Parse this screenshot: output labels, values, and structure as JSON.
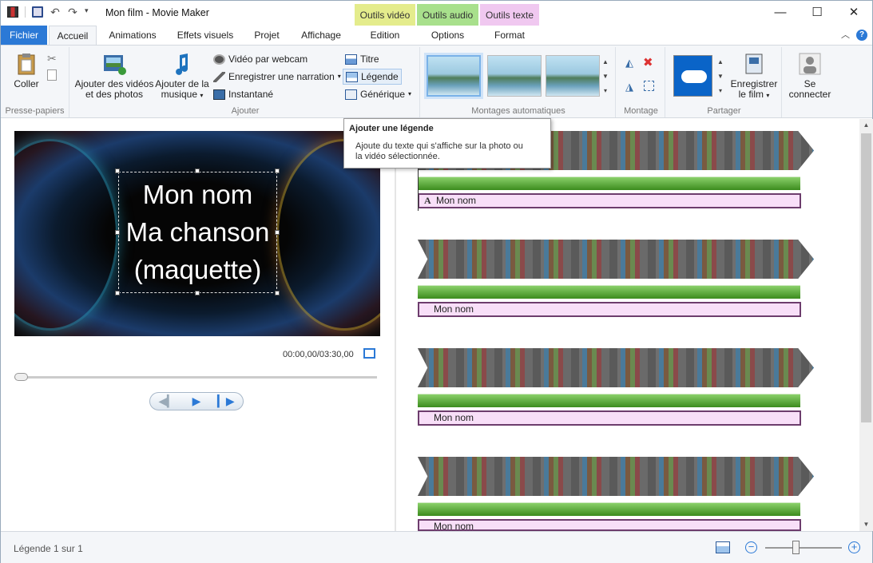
{
  "window": {
    "title": "Mon film - Movie Maker",
    "minimize_glyph": "—",
    "maximize_glyph": "☐",
    "close_glyph": "✕"
  },
  "context_groups": [
    {
      "label": "Outils vidéo",
      "color": "#e4ec8c"
    },
    {
      "label": "Outils audio",
      "color": "#a8e08c"
    },
    {
      "label": "Outils texte",
      "color": "#f0c8f0"
    }
  ],
  "tabs": {
    "file": "Fichier",
    "home": "Accueil",
    "animations": "Animations",
    "visual_effects": "Effets visuels",
    "project": "Projet",
    "view": "Affichage",
    "edit": "Edition",
    "options": "Options",
    "format": "Format"
  },
  "ribbon": {
    "clipboard": {
      "paste": "Coller",
      "group": "Presse-papiers"
    },
    "add": {
      "add_videos_line1": "Ajouter des vidéos",
      "add_videos_line2": "et des photos",
      "add_music_line1": "Ajouter de la",
      "add_music_line2": "musique",
      "webcam": "Vidéo par webcam",
      "narration": "Enregistrer une narration",
      "snapshot": "Instantané",
      "title": "Titre",
      "caption": "Légende",
      "credits": "Générique",
      "group": "Ajouter"
    },
    "automovie": {
      "group": "Montages automatiques"
    },
    "editing": {
      "group": "Montage"
    },
    "share": {
      "save_line1": "Enregistrer",
      "save_line2": "le film",
      "group": "Partager"
    },
    "signin": {
      "line1": "Se",
      "line2": "connecter"
    }
  },
  "tooltip": {
    "title": "Ajouter une légende",
    "body_line1": "Ajoute du texte qui s'affiche sur la photo ou",
    "body_line2": "la vidéo sélectionnée."
  },
  "preview": {
    "caption_line1": "Mon nom",
    "caption_line2": "Ma chanson",
    "caption_line3": "(maquette)",
    "timecode": "00:00,00/03:30,00",
    "seek_position": 0
  },
  "storyboard": {
    "captions": [
      "Mon nom",
      "Mon nom",
      "Mon nom",
      "Mon nom"
    ],
    "caption_icon": "A"
  },
  "status": {
    "text": "Légende 1 sur 1",
    "zoom_fraction": 0.4
  }
}
